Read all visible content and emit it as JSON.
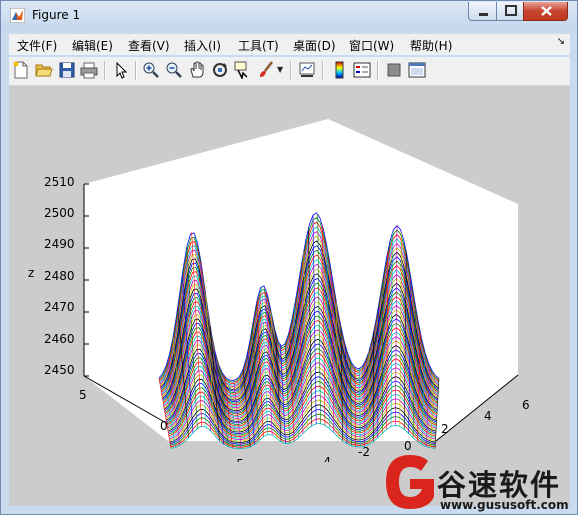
{
  "window": {
    "title": "Figure 1"
  },
  "menu": [
    "文件(F)",
    "编辑(E)",
    "查看(V)",
    "插入(I)",
    "工具(T)",
    "桌面(D)",
    "窗口(W)",
    "帮助(H)"
  ],
  "toolbar": {
    "buttons": [
      {
        "name": "new-figure-icon"
      },
      {
        "name": "open-file-icon"
      },
      {
        "name": "save-icon"
      },
      {
        "name": "print-icon"
      },
      {
        "name": "edit-plot-icon"
      },
      {
        "name": "zoom-in-icon"
      },
      {
        "name": "zoom-out-icon"
      },
      {
        "name": "pan-icon"
      },
      {
        "name": "rotate-3d-icon"
      },
      {
        "name": "data-cursor-icon"
      },
      {
        "name": "brush-icon"
      },
      {
        "name": "link-plot-icon"
      },
      {
        "name": "colorbar-icon"
      },
      {
        "name": "legend-icon"
      },
      {
        "name": "hide-plot-tools-icon"
      },
      {
        "name": "show-plot-tools-icon"
      }
    ]
  },
  "chart_data": {
    "type": "line",
    "render": "3d-mesh",
    "zlabel": "z",
    "ylabel": "y",
    "z_ticks": [
      "2510",
      "2500",
      "2490",
      "2480",
      "2470",
      "2460",
      "2450"
    ],
    "y_ticks": [
      "5",
      "0",
      "-5"
    ],
    "x_ticks": [
      "-6",
      "-4",
      "-2",
      "0",
      "2",
      "4",
      "6"
    ],
    "zlim": [
      2450,
      2510
    ],
    "ylim": [
      -6,
      6
    ],
    "xlim": [
      -6,
      6
    ],
    "series_colors": [
      "#0000ff",
      "#008000",
      "#ff0000",
      "#00bfbf",
      "#bf00bf",
      "#bfbf00",
      "#000000"
    ],
    "grid": false
  },
  "watermark": {
    "title": "谷速软件",
    "url": "www.gususoft.com",
    "accent": "#d9251c"
  }
}
